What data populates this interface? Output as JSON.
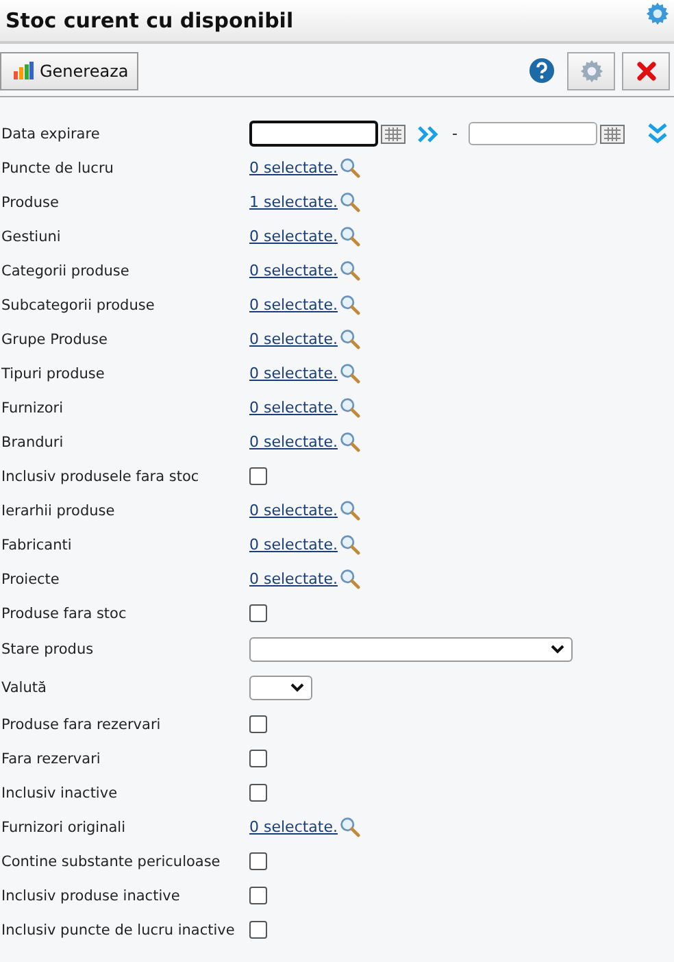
{
  "window": {
    "title": "Stoc curent cu disponibil"
  },
  "toolbar": {
    "generate_button": "Genereaza"
  },
  "rows": [
    {
      "kind": "date",
      "label": "Data expirare",
      "separator": "-"
    },
    {
      "kind": "link",
      "label": "Puncte de lucru",
      "value": "0 selectate."
    },
    {
      "kind": "link",
      "label": "Produse",
      "value": "1 selectate."
    },
    {
      "kind": "link",
      "label": "Gestiuni",
      "value": "0 selectate."
    },
    {
      "kind": "link",
      "label": "Categorii produse",
      "value": "0 selectate."
    },
    {
      "kind": "link",
      "label": "Subcategorii produse",
      "value": "0 selectate."
    },
    {
      "kind": "link",
      "label": "Grupe Produse",
      "value": "0 selectate."
    },
    {
      "kind": "link",
      "label": "Tipuri produse",
      "value": "0 selectate."
    },
    {
      "kind": "link",
      "label": "Furnizori",
      "value": "0 selectate."
    },
    {
      "kind": "link",
      "label": "Branduri",
      "value": "0 selectate."
    },
    {
      "kind": "checkbox",
      "label": "Inclusiv produsele fara stoc",
      "checked": false
    },
    {
      "kind": "link",
      "label": "Ierarhii produse",
      "value": "0 selectate."
    },
    {
      "kind": "link",
      "label": "Fabricanti",
      "value": "0 selectate."
    },
    {
      "kind": "link",
      "label": "Proiecte",
      "value": "0 selectate."
    },
    {
      "kind": "checkbox",
      "label": "Produse fara stoc",
      "checked": false
    },
    {
      "kind": "select",
      "label": "Stare produs"
    },
    {
      "kind": "minselect",
      "label": "Valută"
    },
    {
      "kind": "checkbox",
      "label": "Produse fara rezervari",
      "checked": false
    },
    {
      "kind": "checkbox",
      "label": "Fara rezervari",
      "checked": false
    },
    {
      "kind": "checkbox",
      "label": "Inclusiv inactive",
      "checked": false
    },
    {
      "kind": "link",
      "label": "Furnizori originali",
      "value": "0 selectate."
    },
    {
      "kind": "checkbox",
      "label": "Contine substante periculoase",
      "checked": false
    },
    {
      "kind": "checkbox",
      "label": "Inclusiv produse inactive",
      "checked": false
    },
    {
      "kind": "checkbox",
      "label": "Inclusiv puncte de lucru inactive",
      "checked": false
    }
  ]
}
